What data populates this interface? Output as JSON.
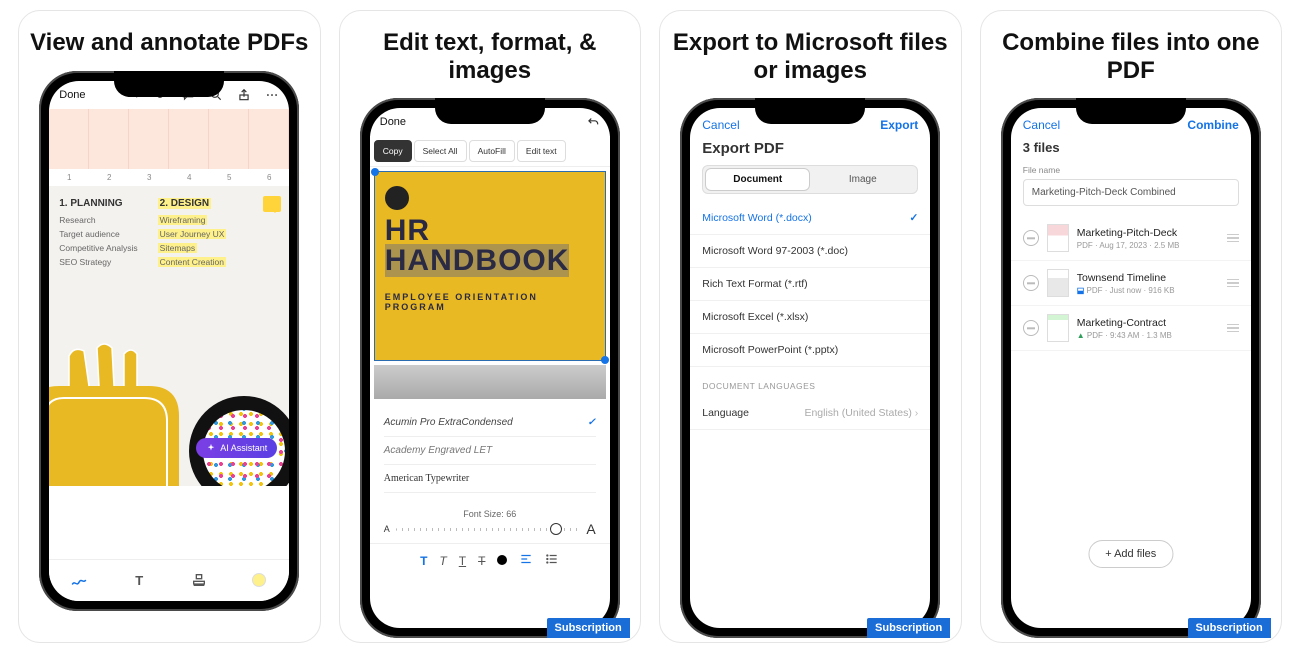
{
  "cards": {
    "c1": {
      "headline": "View and annotate PDFs"
    },
    "c2": {
      "headline": "Edit text, format, & images"
    },
    "c3": {
      "headline": "Export to Microsoft files or images"
    },
    "c4": {
      "headline": "Combine files into one PDF"
    }
  },
  "badge": "Subscription",
  "screen1": {
    "done": "Done",
    "nums": [
      "1",
      "2",
      "3",
      "4",
      "5",
      "6"
    ],
    "col1_title": "1. PLANNING",
    "col1_items": [
      "Research",
      "Target audience",
      "Competitive Analysis",
      "SEO Strategy"
    ],
    "col2_title": "2. DESIGN",
    "col2_items": [
      "Wireframing",
      "User Journey UX",
      "Sitemaps",
      "Content Creation"
    ],
    "ai": "AI Assistant"
  },
  "screen2": {
    "done": "Done",
    "tools": [
      "Copy",
      "Select All",
      "AutoFill",
      "Edit text"
    ],
    "title_l1": "HR",
    "title_l2": "HANDBOOK",
    "subtitle": "EMPLOYEE ORIENTATION PROGRAM",
    "fonts": {
      "f1": "Acumin Pro ExtraCondensed",
      "f2": "Academy Engraved LET",
      "f3": "American Typewriter"
    },
    "size_label": "Font Size: 66",
    "small_a": "A",
    "big_a": "A"
  },
  "screen3": {
    "cancel": "Cancel",
    "export": "Export",
    "title": "Export PDF",
    "tab_doc": "Document",
    "tab_img": "Image",
    "o1": "Microsoft Word (*.docx)",
    "o2": "Microsoft Word 97-2003 (*.doc)",
    "o3": "Rich Text Format (*.rtf)",
    "o4": "Microsoft Excel (*.xlsx)",
    "o5": "Microsoft PowerPoint (*.pptx)",
    "sec": "DOCUMENT LANGUAGES",
    "lang_k": "Language",
    "lang_v": "English (United States)"
  },
  "screen4": {
    "cancel": "Cancel",
    "combine": "Combine",
    "count": "3 files",
    "fn_label": "File name",
    "fn_value": "Marketing-Pitch-Deck Combined",
    "f1": {
      "t": "Marketing-Pitch-Deck",
      "m": "PDF  ·  Aug 17, 2023  ·  2.5 MB"
    },
    "f2": {
      "t": "Townsend Timeline",
      "m_tag": "PDF",
      "m_rest": "  ·  Just now  ·  916 KB"
    },
    "f3": {
      "t": "Marketing-Contract",
      "m_tag": "PDF",
      "m_rest": "  ·  9:43 AM  ·  1.3 MB"
    },
    "add": "+  Add files"
  }
}
